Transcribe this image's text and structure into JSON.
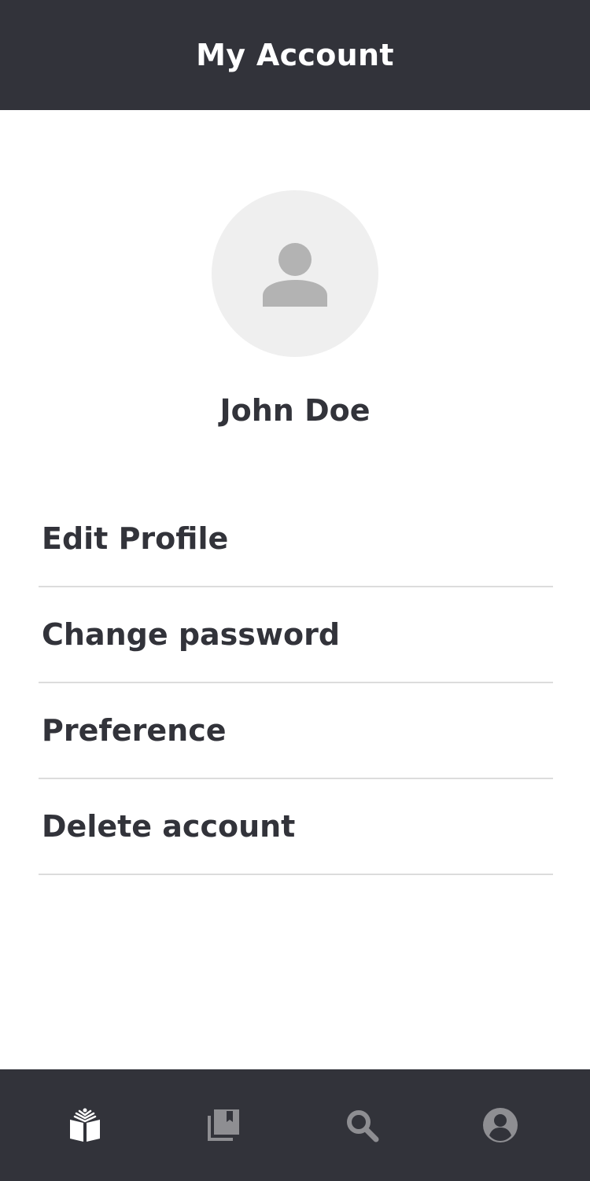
{
  "header": {
    "title": "My Account"
  },
  "profile": {
    "name": "John Doe",
    "avatar_icon": "user-placeholder-icon"
  },
  "menu": {
    "items": [
      {
        "label": "Edit Profile"
      },
      {
        "label": "Change password"
      },
      {
        "label": "Preference"
      },
      {
        "label": "Delete account"
      }
    ]
  },
  "bottom_nav": {
    "items": [
      {
        "icon": "open-book-icon",
        "active": true
      },
      {
        "icon": "library-bookmark-icon",
        "active": false
      },
      {
        "icon": "search-icon",
        "active": false
      },
      {
        "icon": "account-icon",
        "active": false
      }
    ]
  },
  "colors": {
    "header_bg": "#32333a",
    "text": "#32333a",
    "divider": "#dcdcdc",
    "avatar_bg": "#efefef",
    "avatar_icon": "#b3b3b3",
    "nav_active": "#ffffff",
    "nav_inactive": "#8e8e92"
  }
}
